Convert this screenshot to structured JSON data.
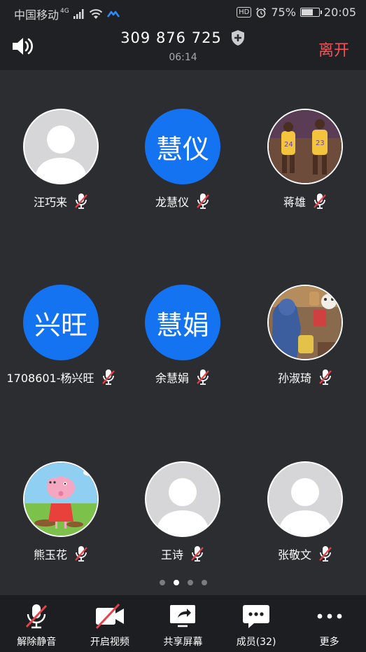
{
  "status_bar": {
    "carrier": "中国移动",
    "network": "4G",
    "battery": "75%",
    "battery_level": 0.75,
    "time": "20:05",
    "hd_label": "HD"
  },
  "header": {
    "meeting_id": "309 876 725",
    "duration": "06:14",
    "leave_label": "离开"
  },
  "participants": [
    {
      "name": "汪巧来",
      "avatar_type": "blank",
      "muted": true
    },
    {
      "name": "龙慧仪",
      "avatar_type": "text",
      "avatar_text": "慧仪",
      "muted": true
    },
    {
      "name": "蒋雄",
      "avatar_type": "photo-basketball",
      "muted": true
    },
    {
      "name": "1708601-杨兴旺",
      "avatar_type": "text",
      "avatar_text": "兴旺",
      "muted": true
    },
    {
      "name": "余慧娟",
      "avatar_type": "text",
      "avatar_text": "慧娟",
      "muted": true
    },
    {
      "name": "孙淑琦",
      "avatar_type": "photo-toys",
      "muted": true
    },
    {
      "name": "熊玉花",
      "avatar_type": "photo-cartoon-pig",
      "muted": true
    },
    {
      "name": "王诗",
      "avatar_type": "blank",
      "muted": true
    },
    {
      "name": "张敬文",
      "avatar_type": "blank",
      "muted": true
    }
  ],
  "pager": {
    "total": 4,
    "active": 2
  },
  "toolbar": {
    "unmute_label": "解除静音",
    "video_label": "开启视频",
    "share_label": "共享屏幕",
    "members_label": "成员(32)",
    "more_label": "更多"
  },
  "colors": {
    "background": "#2b2d31",
    "avatar_blue": "#1473f0",
    "leave_red": "#f0545a",
    "mute_red": "#e8414a"
  }
}
